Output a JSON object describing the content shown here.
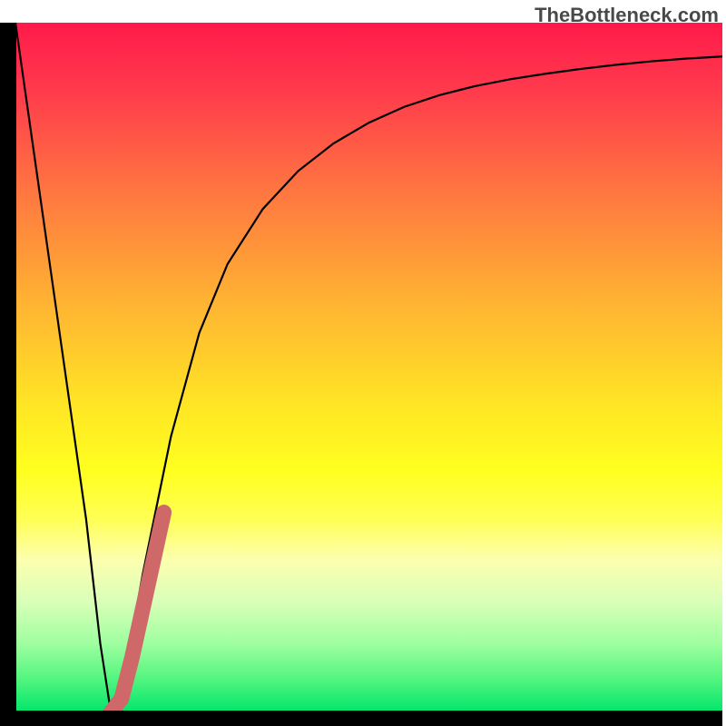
{
  "watermark": "TheBottleneck.com",
  "chart_data": {
    "type": "line",
    "title": "",
    "xlabel": "",
    "ylabel": "",
    "xlim": [
      0,
      100
    ],
    "ylim": [
      0,
      100
    ],
    "series": [
      {
        "name": "bottleneck-curve",
        "x": [
          0,
          5,
          10,
          12,
          13.5,
          15,
          18,
          22,
          26,
          30,
          35,
          40,
          45,
          50,
          55,
          60,
          65,
          70,
          75,
          80,
          85,
          90,
          95,
          100
        ],
        "y": [
          100,
          64,
          28,
          10,
          0,
          3,
          20,
          40,
          55,
          65,
          73,
          78.5,
          82.5,
          85.5,
          87.8,
          89.5,
          90.8,
          91.8,
          92.6,
          93.3,
          93.9,
          94.4,
          94.8,
          95.1
        ]
      }
    ],
    "highlight": {
      "name": "optimal-range",
      "x": [
        13.5,
        15,
        16.5,
        18,
        19.5,
        21
      ],
      "y": [
        0,
        2,
        8,
        15,
        22,
        29
      ],
      "color": "#cf6868"
    },
    "background": {
      "type": "vertical-gradient",
      "description": "red-to-green gradient indicating bottleneck severity",
      "stops": [
        {
          "pos": 0.0,
          "color": "#ff1a4a"
        },
        {
          "pos": 0.25,
          "color": "#ff7840"
        },
        {
          "pos": 0.55,
          "color": "#ffe425"
        },
        {
          "pos": 0.78,
          "color": "#fcffb0"
        },
        {
          "pos": 1.0,
          "color": "#00e66b"
        }
      ]
    }
  }
}
